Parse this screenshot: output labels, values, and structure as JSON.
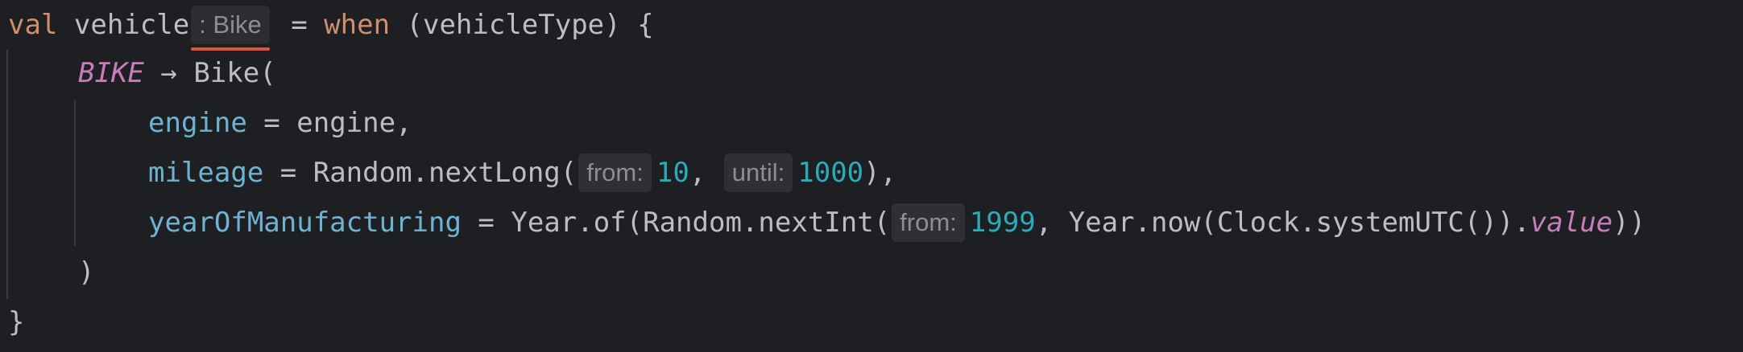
{
  "code": {
    "line1": {
      "kw_val": "val",
      "name": "vehicle",
      "type_hint": ": Bike",
      "assign": " = ",
      "kw_when": "when",
      "rest": " (vehicleType) {"
    },
    "line2": {
      "enum": "BIKE",
      "arrow": " → ",
      "call": "Bike("
    },
    "line3": {
      "param": "engine",
      "assign": " = ",
      "value": "engine,"
    },
    "line4": {
      "param": "mileage",
      "assign": " = ",
      "call": "Random.nextLong(",
      "hint_from": "from:",
      "num_from": "10",
      "sep": ", ",
      "hint_until": "until:",
      "num_until": "1000",
      "close": "),"
    },
    "line5": {
      "param": "yearOfManufacturing",
      "assign": " = ",
      "call": "Year.of(Random.nextInt(",
      "hint_from": "from:",
      "num_from": "1999",
      "mid": ", Year.now(Clock.systemUTC()).",
      "prop": "value",
      "close": "))"
    },
    "line6": {
      "close": ")"
    },
    "line7": {
      "close": "}"
    }
  },
  "colors": {
    "background": "#1e1f22",
    "keyword": "#cf8e6d",
    "number": "#2aacb8",
    "enum": "#c77dbb",
    "error_underline": "#e0533a"
  }
}
